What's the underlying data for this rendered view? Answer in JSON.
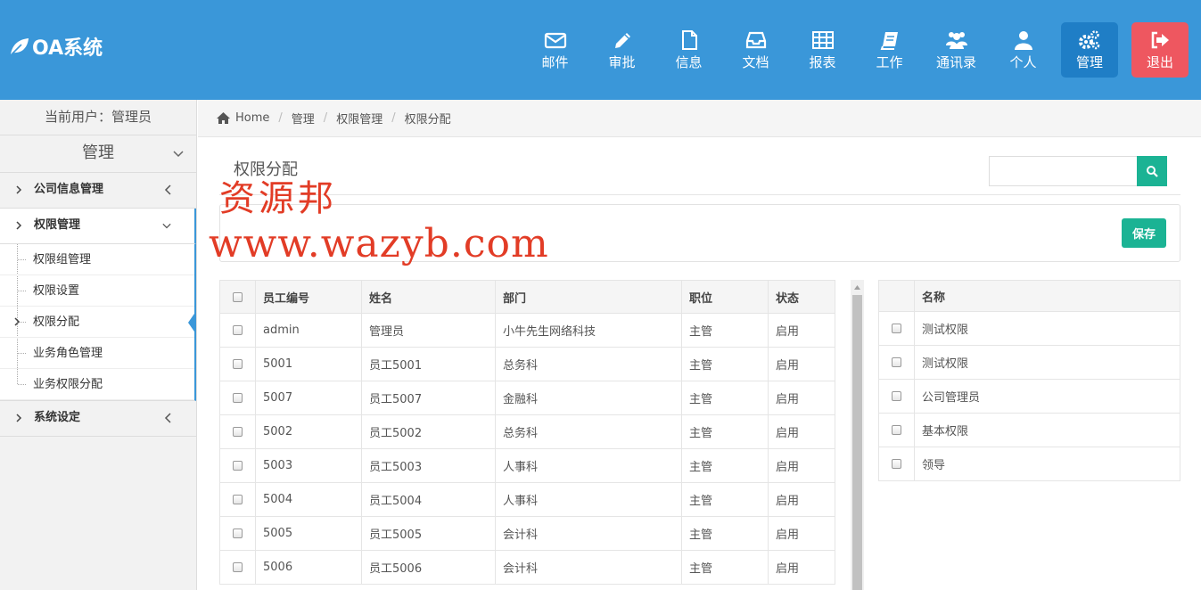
{
  "app": {
    "logo_text": "OA系统"
  },
  "nav": [
    {
      "label": "邮件",
      "icon": "mail-icon"
    },
    {
      "label": "审批",
      "icon": "pencil-icon"
    },
    {
      "label": "信息",
      "icon": "file-icon"
    },
    {
      "label": "文档",
      "icon": "inbox-icon"
    },
    {
      "label": "报表",
      "icon": "table-icon"
    },
    {
      "label": "工作",
      "icon": "book-icon"
    },
    {
      "label": "通讯录",
      "icon": "users-icon"
    },
    {
      "label": "个人",
      "icon": "user-icon"
    },
    {
      "label": "管理",
      "icon": "gears-icon",
      "active": true
    },
    {
      "label": "退出",
      "icon": "logout-icon"
    }
  ],
  "sidebar": {
    "current_user": "当前用户：管理员",
    "section_title": "管理",
    "groups": [
      {
        "label": "公司信息管理"
      },
      {
        "label": "权限管理",
        "items": [
          "权限组管理",
          "权限设置",
          "权限分配",
          "业务角色管理",
          "业务权限分配"
        ],
        "active_item": "权限分配"
      },
      {
        "label": "系统设定"
      }
    ]
  },
  "breadcrumb": {
    "home": "Home",
    "items": [
      "管理",
      "权限管理",
      "权限分配"
    ]
  },
  "page": {
    "title": "权限分配",
    "save_label": "保存",
    "search_placeholder": ""
  },
  "watermark": {
    "line1": "资源邦",
    "line2": "www.wazyb.com"
  },
  "employees": {
    "columns": [
      "员工编号",
      "姓名",
      "部门",
      "职位",
      "状态"
    ],
    "rows": [
      [
        "admin",
        "管理员",
        "小牛先生网络科技",
        "主管",
        "启用"
      ],
      [
        "5001",
        "员工5001",
        "总务科",
        "主管",
        "启用"
      ],
      [
        "5007",
        "员工5007",
        "金融科",
        "主管",
        "启用"
      ],
      [
        "5002",
        "员工5002",
        "总务科",
        "主管",
        "启用"
      ],
      [
        "5003",
        "员工5003",
        "人事科",
        "主管",
        "启用"
      ],
      [
        "5004",
        "员工5004",
        "人事科",
        "主管",
        "启用"
      ],
      [
        "5005",
        "员工5005",
        "会计科",
        "主管",
        "启用"
      ],
      [
        "5006",
        "员工5006",
        "会计科",
        "主管",
        "启用"
      ]
    ]
  },
  "roles": {
    "column": "名称",
    "rows": [
      "测试权限",
      "测试权限",
      "公司管理员",
      "基本权限",
      "领导"
    ]
  },
  "colors": {
    "header": "#3a97d9",
    "active_nav": "#1f7ec6",
    "logout": "#ee5760",
    "accent_green": "#1bb394",
    "watermark": "#e23c26"
  }
}
